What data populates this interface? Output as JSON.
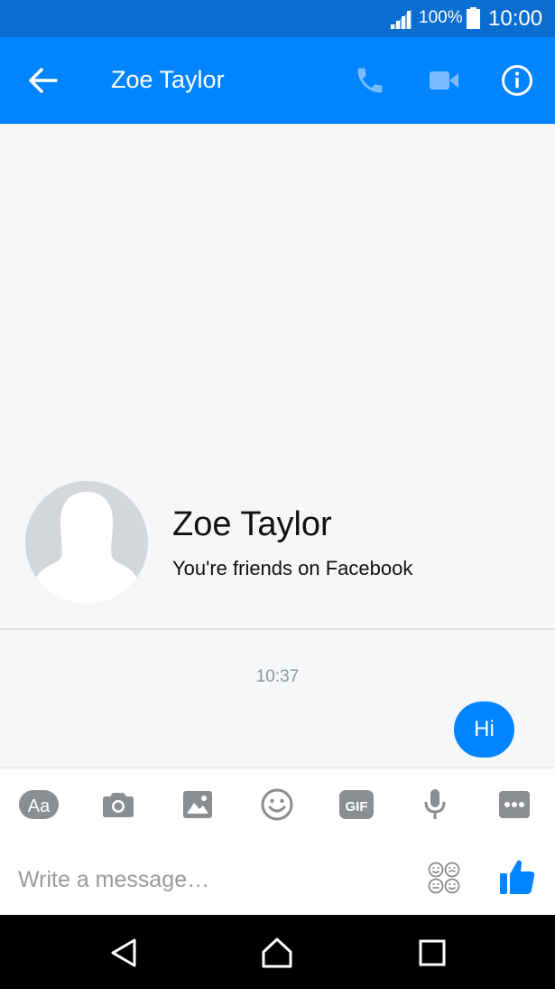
{
  "status_bar": {
    "battery_percent": "100%",
    "time": "10:00"
  },
  "header": {
    "title": "Zoe Taylor",
    "icons": [
      "back-arrow-icon",
      "phone-icon",
      "video-camera-icon",
      "info-icon"
    ]
  },
  "profile": {
    "name": "Zoe Taylor",
    "subtitle": "You're friends on Facebook"
  },
  "conversation": {
    "timestamp": "10:37",
    "messages": [
      {
        "text": "Hi",
        "sender": "me"
      }
    ]
  },
  "composer": {
    "text_format_label": "Aa",
    "gif_label": "GIF",
    "placeholder": "Write a message…",
    "toolbar_icons": [
      "text-format-icon",
      "camera-icon",
      "image-icon",
      "emoji-icon",
      "gif-icon",
      "microphone-icon",
      "more-icon"
    ]
  },
  "colors": {
    "status_bar": "#0a6ed1",
    "header": "#0084ff",
    "bubble": "#0084ff",
    "toolbar_icon": "#8a8d91"
  }
}
